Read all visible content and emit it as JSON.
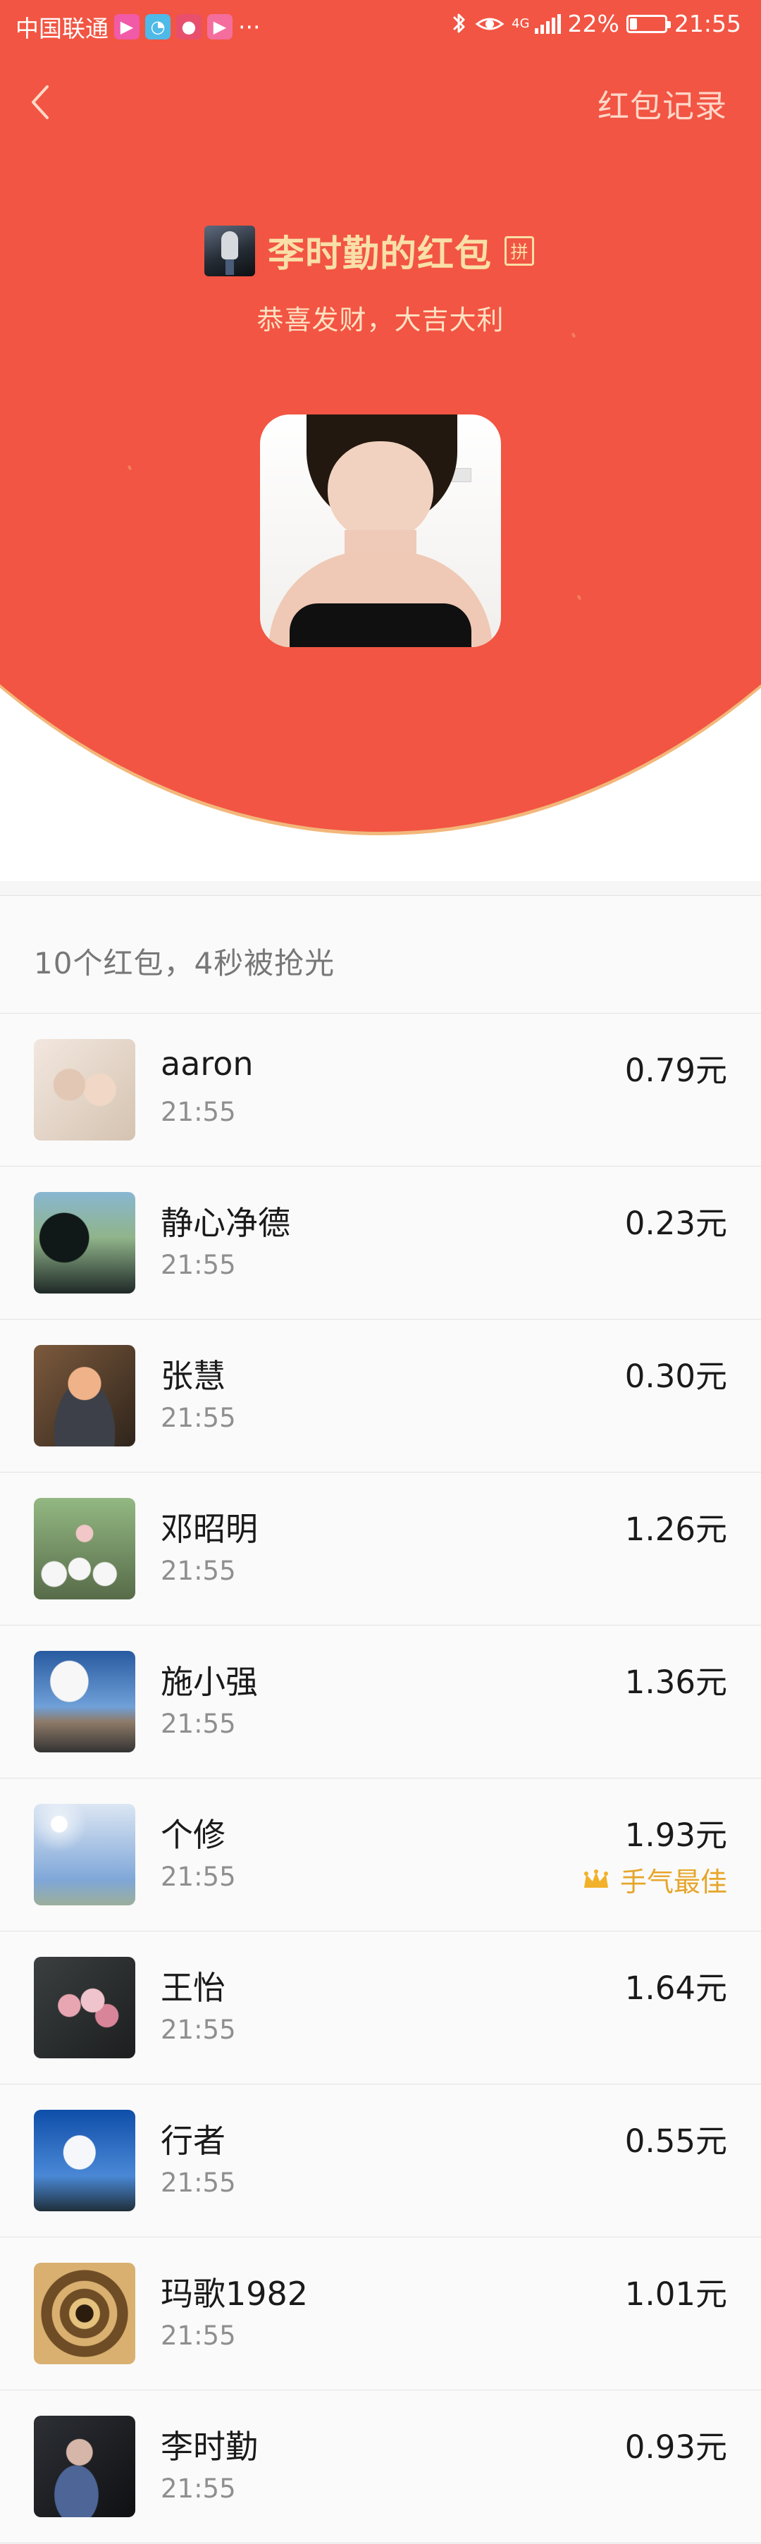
{
  "status": {
    "carrier": "中国联通",
    "notification_apps": [
      {
        "icon": "app-notification-icon",
        "symbol": "▶",
        "color": "#f15aa7"
      },
      {
        "icon": "app-notification-icon",
        "symbol": "◔",
        "color": "#4fb9e8"
      },
      {
        "icon": "app-notification-icon",
        "symbol": "●",
        "color": "#e84f6d"
      },
      {
        "icon": "app-notification-icon",
        "symbol": "▶",
        "color": "#f46d9d"
      }
    ],
    "more": "···",
    "network": "4G",
    "battery": "22%",
    "battery_level": 0.22,
    "time": "21:55"
  },
  "header": {
    "back_label": "返回",
    "records": "红包记录"
  },
  "sender": {
    "title": "李时勤的红包",
    "pin_badge": "拼",
    "blessing": "恭喜发财，大吉大利"
  },
  "summary": {
    "text": "10个红包，4秒被抢光"
  },
  "records": [
    {
      "name": "aaron",
      "time": "21:55",
      "amount": "0.79元",
      "avatar": "children-photo",
      "colors": [
        "#f2e7df",
        "#d5c3b1"
      ]
    },
    {
      "name": "静心净德",
      "time": "21:55",
      "amount": "0.23元",
      "avatar": "landscape-photo",
      "colors": [
        "#1f2927",
        "#88b6d1"
      ]
    },
    {
      "name": "张慧",
      "time": "21:55",
      "amount": "0.30元",
      "avatar": "man-portrait-photo",
      "colors": [
        "#f0b288",
        "#66462d"
      ]
    },
    {
      "name": "邓昭明",
      "time": "21:55",
      "amount": "1.26元",
      "avatar": "panda-photo",
      "colors": [
        "#576b49",
        "#f6f6f6"
      ]
    },
    {
      "name": "施小强",
      "time": "21:55",
      "amount": "1.36元",
      "avatar": "sky-road-photo",
      "colors": [
        "#285aa0",
        "#f7f7f7"
      ]
    },
    {
      "name": "个修",
      "time": "21:55",
      "amount": "1.93元",
      "avatar": "sun-sky-photo",
      "colors": [
        "#7fa7d8",
        "#dce6f3"
      ],
      "best": "手气最佳"
    },
    {
      "name": "王怡",
      "time": "21:55",
      "amount": "1.64元",
      "avatar": "flower-photo",
      "colors": [
        "#1c1e1f",
        "#e8a5b2"
      ]
    },
    {
      "name": "行者",
      "time": "21:55",
      "amount": "0.55元",
      "avatar": "cloud-sky-photo",
      "colors": [
        "#0f4ea9",
        "#f5f7fb"
      ]
    },
    {
      "name": "玛歌1982",
      "time": "21:55",
      "amount": "1.01元",
      "avatar": "mandala-photo",
      "colors": [
        "#6e4c25",
        "#d9b070"
      ]
    },
    {
      "name": "李时勤",
      "time": "21:55",
      "amount": "0.93元",
      "avatar": "man-dark-photo",
      "colors": [
        "#0f1013",
        "#4d6597"
      ]
    }
  ]
}
